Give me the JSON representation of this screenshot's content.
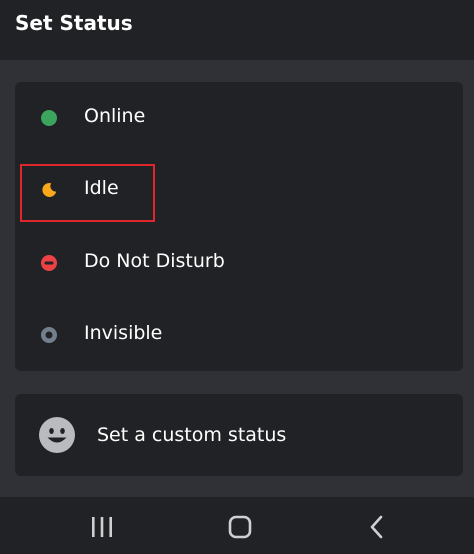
{
  "header": {
    "title": "Set Status"
  },
  "statuses": [
    {
      "label": "Online",
      "icon": "online-dot-icon",
      "color": "#3ba55d"
    },
    {
      "label": "Idle",
      "icon": "idle-moon-icon",
      "color": "#faa81a"
    },
    {
      "label": "Do Not Disturb",
      "icon": "do-not-disturb-icon",
      "color": "#ed4245"
    },
    {
      "label": "Invisible",
      "icon": "invisible-ring-icon",
      "color": "#747f8d"
    }
  ],
  "custom_status": {
    "label": "Set a custom status",
    "icon": "smiley-face-icon"
  },
  "navbar": {
    "buttons": [
      "recent-apps",
      "home",
      "back"
    ]
  },
  "colors": {
    "background": "#2f3136",
    "panel": "#202225",
    "highlight": "#e0262d"
  }
}
